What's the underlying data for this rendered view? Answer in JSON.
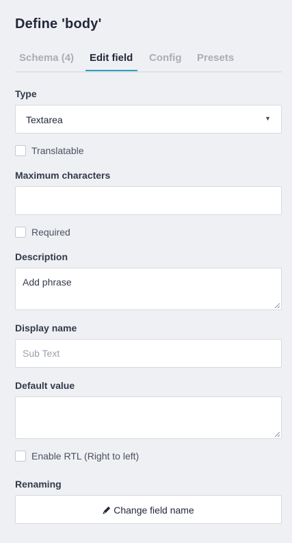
{
  "title": "Define 'body'",
  "tabs": [
    {
      "label": "Schema (4)",
      "active": false
    },
    {
      "label": "Edit field",
      "active": true
    },
    {
      "label": "Config",
      "active": false
    },
    {
      "label": "Presets",
      "active": false
    }
  ],
  "form": {
    "type_label": "Type",
    "type_value": "Textarea",
    "translatable_label": "Translatable",
    "translatable_checked": false,
    "max_chars_label": "Maximum characters",
    "max_chars_value": "",
    "required_label": "Required",
    "required_checked": false,
    "description_label": "Description",
    "description_value": "Add phrase",
    "display_name_label": "Display name",
    "display_name_placeholder": "Sub Text",
    "display_name_value": "",
    "default_value_label": "Default value",
    "default_value_value": "",
    "rtl_label": "Enable RTL (Right to left)",
    "rtl_checked": false,
    "renaming_label": "Renaming",
    "change_field_button": "Change field name"
  },
  "colors": {
    "background": "#eff0f4",
    "accent": "#2b9fc1",
    "text_dark": "#22283a",
    "tab_inactive": "#a9adb7"
  },
  "icons": {
    "caret": "triangle-down-icon",
    "button_icon": "pencil-icon"
  }
}
